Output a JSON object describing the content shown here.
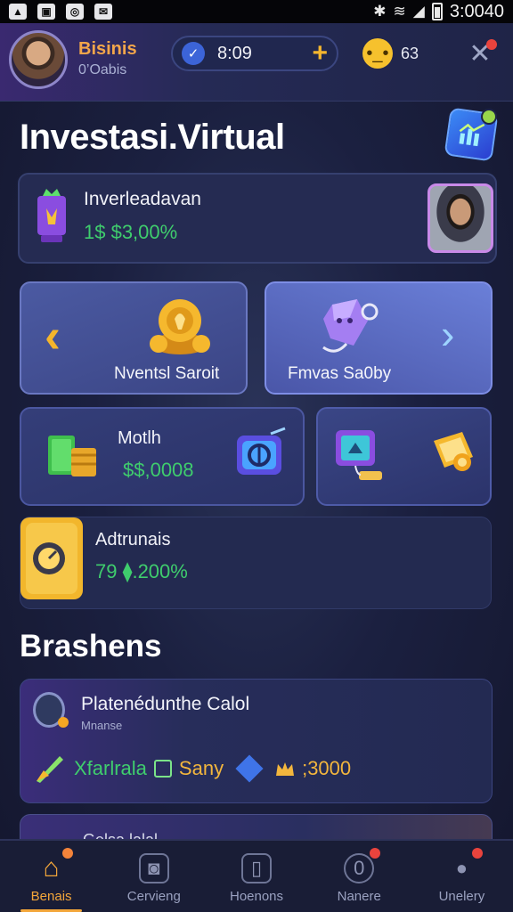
{
  "status_bar": {
    "time": "3:0040",
    "left_icons": [
      "photo-icon",
      "image-icon",
      "whatsapp-icon",
      "mail-icon"
    ],
    "right_icons": [
      "bluetooth-icon",
      "wifi-icon",
      "signal-icon",
      "battery-icon"
    ]
  },
  "header": {
    "business_name": "Bisinis",
    "business_sub": "0’Oabis",
    "timer": "8:09",
    "plus": "+",
    "emoji_count": "63",
    "accent_color": "#f3a64a"
  },
  "page": {
    "title": "Investasi.Virtual"
  },
  "balance_card": {
    "label": "Inverleadavan",
    "value": "1$ $3,00%"
  },
  "tiles": [
    {
      "label": "Nventsl Saroit"
    },
    {
      "label": "Fmvas Sa0by"
    }
  ],
  "money_card": {
    "label": "Motlh",
    "value": "$$,0008"
  },
  "tracker_card": {
    "label": "Adtrunais",
    "value": "79 ⧫.200%"
  },
  "section": {
    "title": "Brashens"
  },
  "business_card": {
    "title": "Platenédunthe Calol",
    "subtitle": "Mnanse",
    "text1": "Xfarlrala",
    "text2": "Sany",
    "value": ";3000"
  },
  "partial_card": {
    "text": "Gelsa lalal"
  },
  "bottom_nav": [
    {
      "label": "Benais",
      "icon": "home-icon",
      "active": true
    },
    {
      "label": "Cervieng",
      "icon": "camera-icon",
      "active": false
    },
    {
      "label": "Hoenons",
      "icon": "phone-icon",
      "active": false
    },
    {
      "label": "Nanere",
      "icon": "compass-icon",
      "active": false
    },
    {
      "label": "Unelery",
      "icon": "user-icon",
      "active": false
    }
  ],
  "colors": {
    "background": "#1b2040",
    "value_green": "#3fcd6d",
    "gold": "#f3b63d",
    "alert_red": "#e9433d"
  }
}
